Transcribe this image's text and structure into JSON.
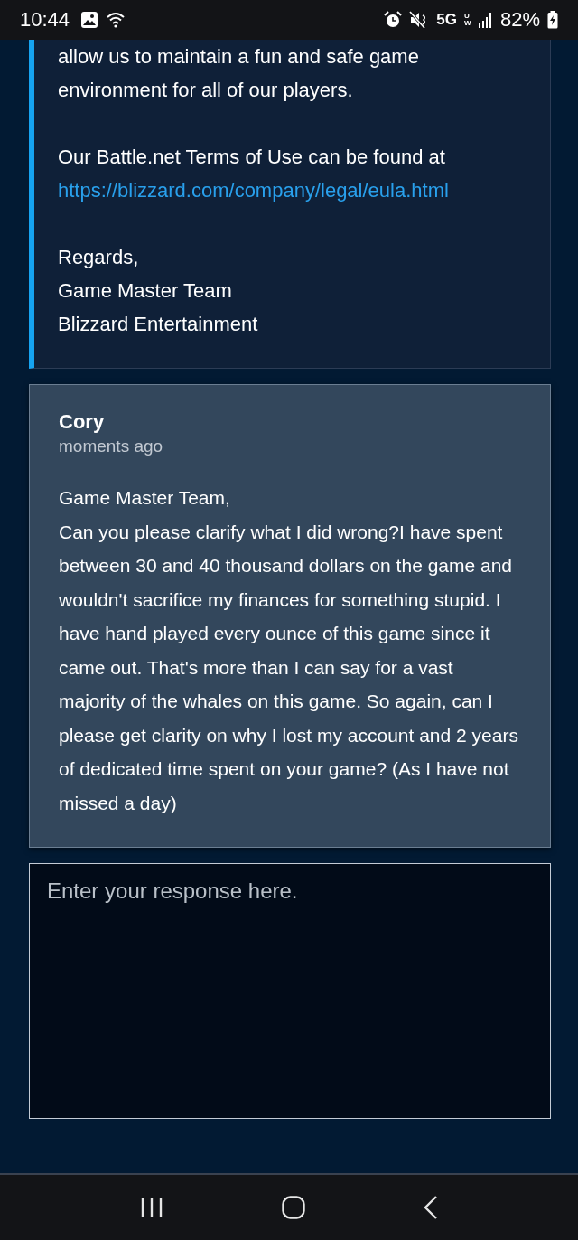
{
  "status_bar": {
    "time": "10:44",
    "network": "5G",
    "network_sub": "UW",
    "battery": "82%"
  },
  "gm_message": {
    "paragraphs": [
      {
        "kind": "text",
        "text": "allow us to maintain a fun and safe game environment for all of our players."
      },
      {
        "kind": "text_link",
        "text": "Our Battle.net Terms of Use can be found at",
        "link": "https://blizzard.com/company/legal/eula.html"
      },
      {
        "kind": "lines",
        "lines": [
          "Regards,",
          "Game Master Team",
          "Blizzard Entertainment"
        ]
      }
    ]
  },
  "reply": {
    "author": "Cory",
    "time": "moments ago",
    "greeting": "Game Master Team,",
    "body": "Can you please clarify what I did wrong?I have spent between 30 and 40 thousand dollars on the game and wouldn't sacrifice my finances for something stupid. I have hand played every ounce of this game since it came out.  That's more than I can say for a vast majority of the whales on this game.  So again,  can I please get clarity on why I lost my account and 2 years of dedicated time spent on your game? (As I have not missed a day)"
  },
  "response": {
    "placeholder": "Enter your response here."
  }
}
